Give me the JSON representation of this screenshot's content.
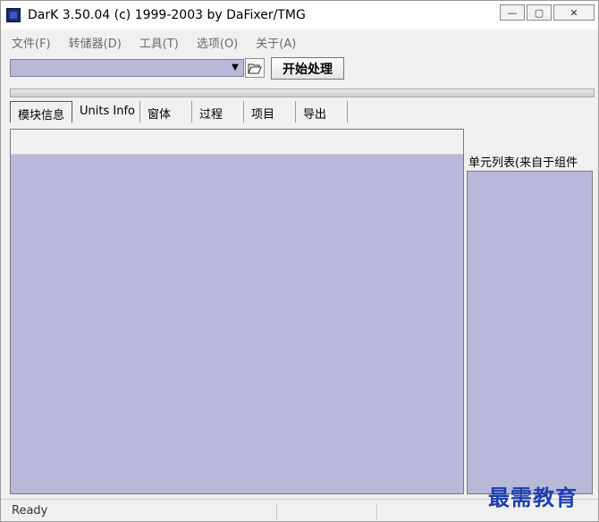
{
  "window": {
    "title": "DarK 3.50.04 (c) 1999-2003 by DaFixer/TMG",
    "controls": {
      "minimize": "—",
      "maximize": "▢",
      "close": "✕"
    }
  },
  "menu": {
    "items": [
      {
        "label": "文件(F)"
      },
      {
        "label": "转储器(D)"
      },
      {
        "label": "工具(T)"
      },
      {
        "label": "选项(O)"
      },
      {
        "label": "关于(A)"
      }
    ]
  },
  "toolbar": {
    "file_combo_value": "",
    "start_button": "开始处理",
    "folder_icon": "folder-open-icon",
    "dropdown_icon": "chevron-down-icon"
  },
  "progress": {
    "fraction": 0
  },
  "tabs": [
    {
      "label": "模块信息",
      "active": true
    },
    {
      "label": "Units Info",
      "active": false
    },
    {
      "label": "窗体",
      "active": false
    },
    {
      "label": "过程",
      "active": false
    },
    {
      "label": "项目",
      "active": false
    },
    {
      "label": "导出",
      "active": false
    }
  ],
  "side_panel": {
    "label": "单元列表(来自于组件"
  },
  "status": {
    "text": "Ready"
  },
  "watermark": "最需教育",
  "colors": {
    "panel_fill": "#b8b9d8",
    "window_bg": "#f0f0f0",
    "watermark": "#1f3fb0"
  }
}
